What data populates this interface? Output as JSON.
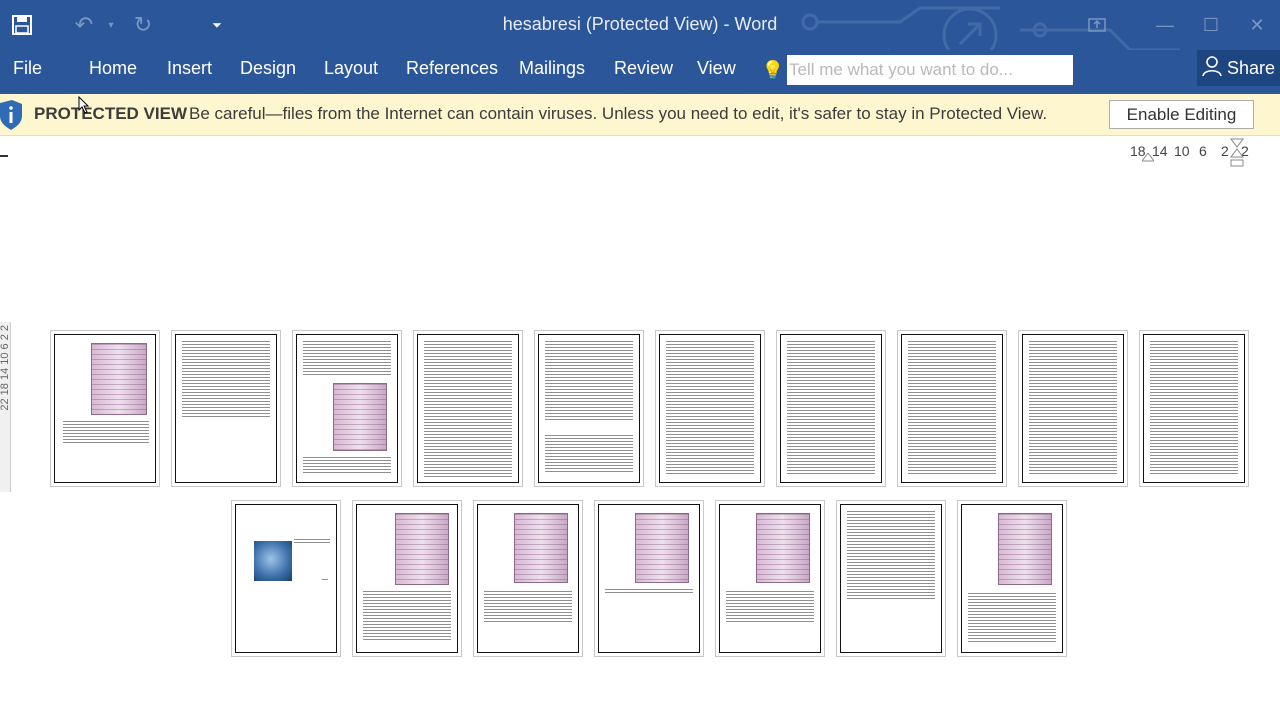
{
  "window": {
    "title": "hesabresi (Protected View) - Word",
    "quick_access": [
      "save-icon",
      "undo-icon",
      "redo-icon",
      "customize-icon"
    ]
  },
  "ribbon": {
    "file": "File",
    "tabs": [
      "Home",
      "Insert",
      "Design",
      "Layout",
      "References",
      "Mailings",
      "Review",
      "View"
    ],
    "tell_me_placeholder": "Tell me what you want to do...",
    "share": "Share"
  },
  "protected_view": {
    "label": "PROTECTED VIEW",
    "message": "Be careful—files from the Internet can contain viruses. Unless you need to edit, it's safer to stay in Protected View.",
    "button": "Enable Editing"
  },
  "ruler": {
    "numbers": [
      "18",
      "14",
      "10",
      "6",
      "2",
      "2"
    ],
    "vertical": "22 18 14 10 6 2 2"
  },
  "colors": {
    "ribbon": "#2b579a",
    "protected_bar": "#fdf6cf"
  }
}
